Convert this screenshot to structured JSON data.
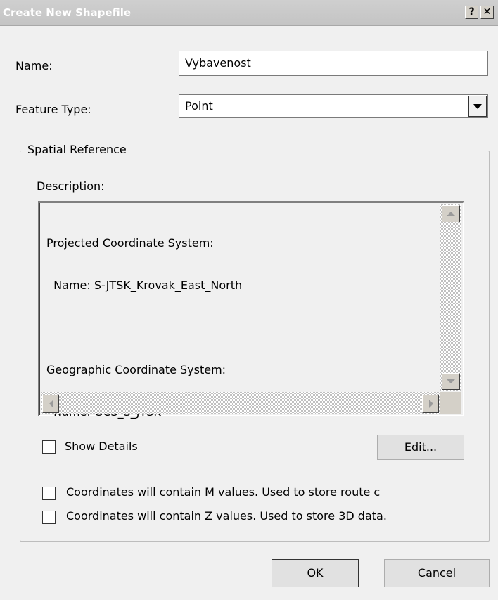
{
  "window": {
    "title": "Create New Shapefile",
    "help_label": "?",
    "close_label": "✕"
  },
  "form": {
    "name_label": "Name:",
    "name_value": "Vybavenost",
    "feature_type_label": "Feature Type:",
    "feature_type_value": "Point"
  },
  "spatial_reference": {
    "group_label": "Spatial Reference",
    "description_label": "Description:",
    "description_lines": [
      "Projected Coordinate System:",
      "  Name: S-JTSK_Krovak_East_North",
      "",
      "Geographic Coordinate System:",
      "  Name: GCS_S_JTSK"
    ],
    "show_details_label": "Show Details",
    "edit_label": "Edit...",
    "m_values_label": "Coordinates will contain M values. Used to store route c",
    "z_values_label": "Coordinates will contain Z values. Used to store 3D data."
  },
  "buttons": {
    "ok_label": "OK",
    "cancel_label": "Cancel"
  }
}
